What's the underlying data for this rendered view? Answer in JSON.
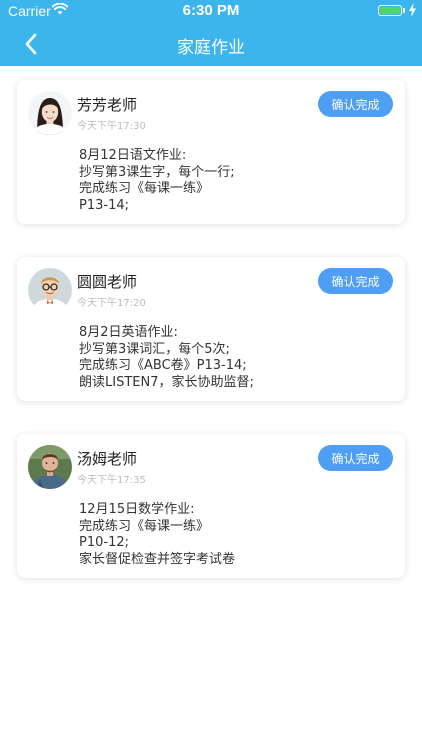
{
  "status_bar": {
    "carrier": "Carrier",
    "time": "6:30 PM"
  },
  "nav": {
    "title": "家庭作业"
  },
  "assignments": [
    {
      "teacher": "芳芳老师",
      "time": "今天下午17:30",
      "button_label": "确认完成",
      "lines": [
        "8月12日语文作业:",
        "抄写第3课生字，每个一行;",
        "完成练习《每课一练》",
        "P13-14;"
      ]
    },
    {
      "teacher": "圆圆老师",
      "time": "今天下午17:20",
      "button_label": "确认完成",
      "lines": [
        "8月2日英语作业:",
        "抄写第3课词汇，每个5次;",
        "完成练习《ABC卷》P13-14;",
        "朗读LISTEN7，家长协助监督;"
      ]
    },
    {
      "teacher": "汤姆老师",
      "time": "今天下午17:35",
      "button_label": "确认完成",
      "lines": [
        "12月15日数学作业:",
        "完成练习《每课一练》",
        "P10-12;",
        "家长督促检查并签字考试卷"
      ]
    }
  ],
  "colors": {
    "header": "#3cb4ec",
    "button": "#4e9ff3",
    "battery": "#4cd964"
  },
  "icons": {
    "back": "chevron-left-icon",
    "wifi": "wifi-icon",
    "battery": "battery-icon",
    "charging": "charging-bolt-icon"
  }
}
